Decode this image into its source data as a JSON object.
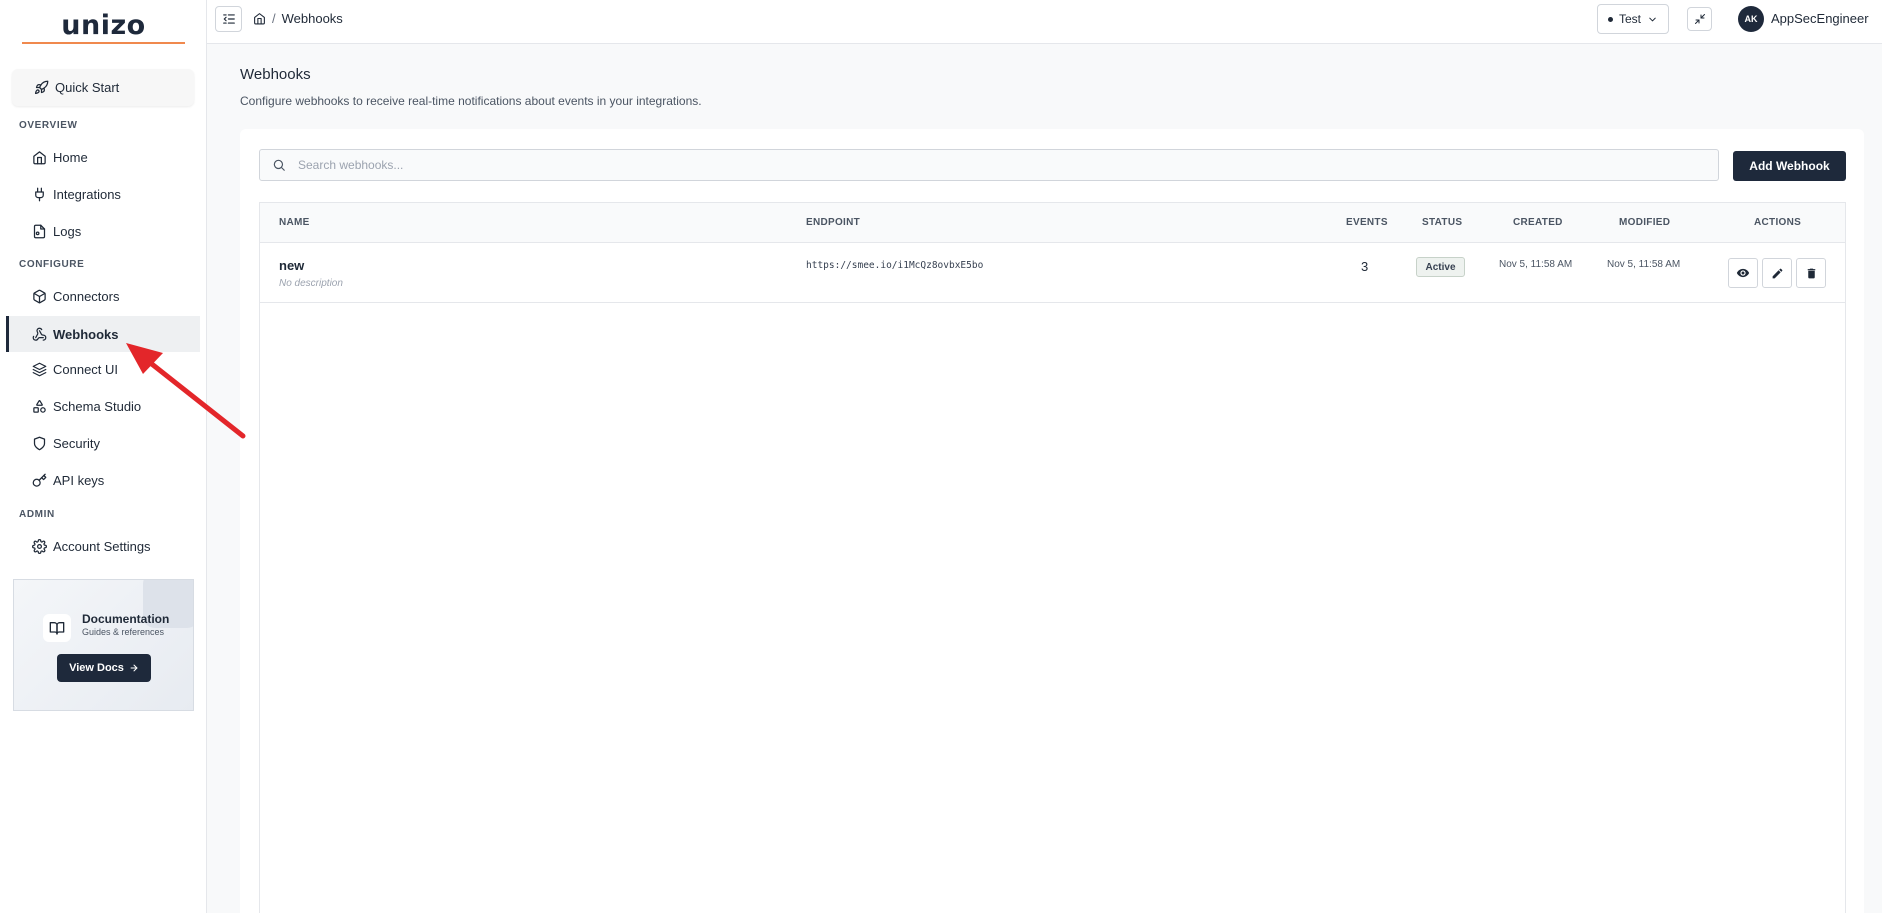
{
  "app": {
    "logo": "unizo"
  },
  "sidebar": {
    "quick_start": "Quick Start",
    "sections": {
      "overview": "OVERVIEW",
      "configure": "CONFIGURE",
      "admin": "ADMIN"
    },
    "items": {
      "home": "Home",
      "integrations": "Integrations",
      "logs": "Logs",
      "connectors": "Connectors",
      "webhooks": "Webhooks",
      "connect_ui": "Connect UI",
      "schema_studio": "Schema Studio",
      "security": "Security",
      "api_keys": "API keys",
      "account_settings": "Account Settings"
    },
    "active_item": "webhooks",
    "doc_card": {
      "title": "Documentation",
      "subtitle": "Guides & references",
      "button": "View Docs"
    }
  },
  "header": {
    "breadcrumb_sep": "/",
    "breadcrumb_current": "Webhooks",
    "environment": "Test",
    "user_initials": "AK",
    "user_name": "AppSecEngineer"
  },
  "page": {
    "title": "Webhooks",
    "description": "Configure webhooks to receive real-time notifications about events in your integrations.",
    "search_placeholder": "Search webhooks...",
    "add_button": "Add Webhook"
  },
  "table": {
    "columns": {
      "name": "NAME",
      "endpoint": "ENDPOINT",
      "events": "EVENTS",
      "status": "STATUS",
      "created": "CREATED",
      "modified": "MODIFIED",
      "actions": "ACTIONS"
    },
    "rows": [
      {
        "name": "new",
        "description": "No description",
        "endpoint": "https://smee.io/i1McQz8ovbxE5bo",
        "events": "3",
        "status": "Active",
        "created": "Nov 5, 11:58 AM",
        "modified": "Nov 5, 11:58 AM"
      }
    ]
  },
  "colors": {
    "primary": "#1e293b",
    "accent": "#f0894e",
    "annotation_arrow": "#e3262a"
  }
}
